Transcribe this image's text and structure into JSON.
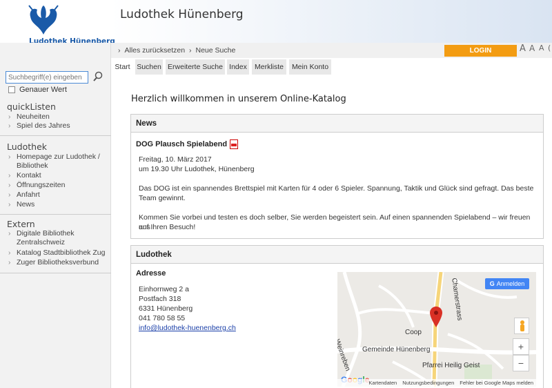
{
  "site": {
    "logo_text": "Ludothek Hünenberg",
    "title": "Ludothek Hünenberg"
  },
  "actions": {
    "reset": "Alles zurücksetzen",
    "new_search": "Neue Suche",
    "login": "LOGIN",
    "font_sizes": [
      "A",
      "A",
      "A"
    ],
    "font_fourth": "("
  },
  "tabs": [
    "Start",
    "Suchen",
    "Erweiterte Suche",
    "Index",
    "Merkliste",
    "Mein Konto"
  ],
  "search": {
    "placeholder": "Suchbegriff(e) eingeben",
    "exact_label": "Genauer Wert"
  },
  "sidebar": {
    "quicklists": {
      "title": "quickListen",
      "items": [
        "Neuheiten",
        "Spiel des Jahres"
      ]
    },
    "ludothek": {
      "title": "Ludothek",
      "items": [
        "Homepage zur Ludothek /",
        "Bibliothek",
        "Kontakt",
        "Öffnungszeiten",
        "Anfahrt",
        "News"
      ]
    },
    "extern": {
      "title": "Extern",
      "items": [
        "Digitale Bibliothek",
        "Zentralschweiz",
        "Katalog Stadtbibliothek Zug",
        "Zuger Bibliotheksverbund"
      ]
    }
  },
  "main": {
    "welcome": "Herzlich willkommen in unserem Online-Katalog",
    "news": {
      "heading": "News",
      "title": "DOG Plausch Spielabend",
      "date": "Freitag, 10. März 2017",
      "time": "um 19.30 Uhr Ludothek, Hünenberg",
      "para1_line1": "Das DOG ist ein spannendes Brettspiel mit Karten für 4 oder 6 Spieler. Spannung, Taktik und Glück sind gefragt. Das beste",
      "para1_line2": "Team gewinnt.",
      "para2_line1": "Kommen Sie vorbei und testen es doch selber, Sie werden begeistert sein. Auf einen spannenden Spielabend – wir freuen uns",
      "para2_line2": "auf Ihren Besuch!"
    },
    "ludothek": {
      "heading": "Ludothek",
      "address_title": "Adresse",
      "street": "Einhornweg 2 a",
      "postbox": "Postfach 318",
      "city": "6331 Hünenberg",
      "phone": "041 780 58 55",
      "email": "info@ludothek-huenenberg.ch"
    },
    "map": {
      "signin": "Anmelden",
      "labels": {
        "street1": "Chamerstrass",
        "street2": "Weinreben",
        "coop": "Coop",
        "gemeinde": "Gemeinde Hünenberg",
        "pfarrei": "Pfarrei Heilig Geist"
      },
      "zoom_in": "+",
      "zoom_out": "−",
      "google": "Google",
      "footer": [
        "Kartendaten",
        "Nutzungsbedingungen",
        "Fehler bei Google Maps melden"
      ]
    }
  }
}
